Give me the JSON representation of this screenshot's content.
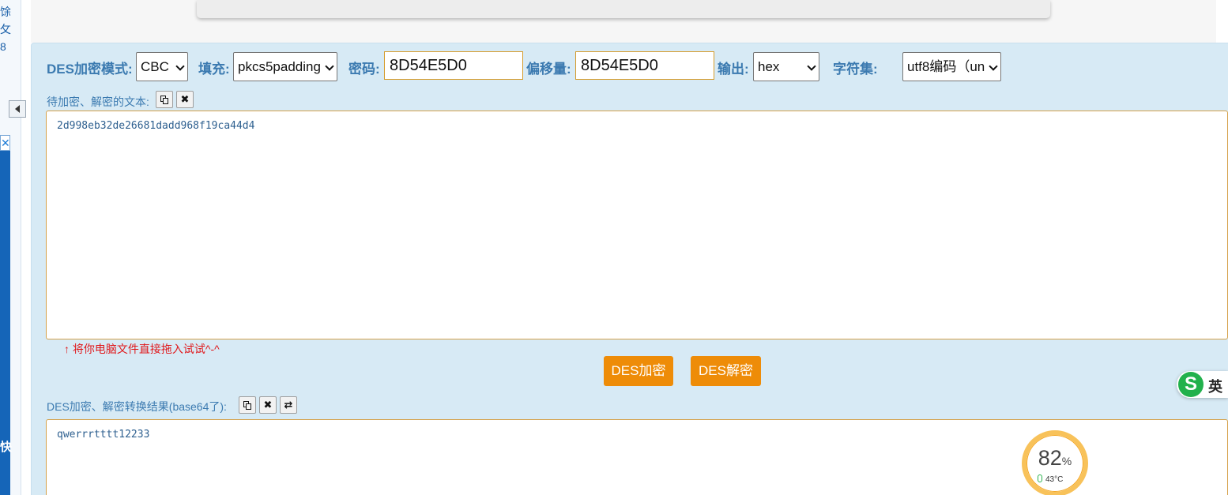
{
  "sidebar": {
    "partial_text": [
      "馀",
      "攵",
      "8"
    ],
    "ad_char": "快"
  },
  "options": {
    "mode_label": "DES加密模式:",
    "mode_value": "CBC",
    "padding_label": "填充:",
    "padding_value": "pkcs5padding",
    "password_label": "密码:",
    "password_value": "8D54E5D0",
    "offset_label": "偏移量:",
    "offset_value": "8D54E5D0",
    "output_label": "输出:",
    "output_value": "hex",
    "charset_label": "字符集:",
    "charset_value": "utf8编码（un"
  },
  "input_section": {
    "label": "待加密、解密的文本:",
    "text": "2d998eb32de26681dadd968f19ca44d4",
    "hint": "↑ 将你电脑文件直接拖入试试^-^"
  },
  "actions": {
    "encrypt": "DES加密",
    "decrypt": "DES解密"
  },
  "output_section": {
    "label": "DES加密、解密转换结果(base64了):",
    "text": "qwerrrtttt12233"
  },
  "ime": {
    "logo": "S",
    "mode": "英"
  },
  "gauge": {
    "value": "82",
    "unit": "%",
    "temperature": "43°C",
    "color": "#f4a520"
  }
}
